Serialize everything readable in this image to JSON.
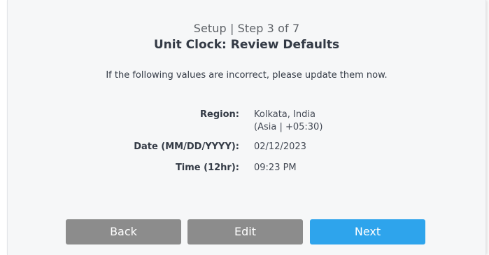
{
  "header": {
    "step_text": "Setup | Step 3 of 7",
    "title": "Unit Clock: Review Defaults"
  },
  "instruction": "If the following values are incorrect, please update them now.",
  "fields": {
    "region": {
      "label": "Region:",
      "value_line1": "Kolkata, India",
      "value_line2": "(Asia | +05:30)"
    },
    "date": {
      "label": "Date (MM/DD/YYYY):",
      "value": "02/12/2023"
    },
    "time": {
      "label": "Time (12hr):",
      "value": "09:23 PM"
    }
  },
  "buttons": {
    "back_label": "Back",
    "edit_label": "Edit",
    "next_label": "Next"
  },
  "colors": {
    "panel_background": "#f6f7f8",
    "secondary_button": "#8c8c8c",
    "primary_button": "#2ea4ec",
    "text_dark": "#333a45"
  }
}
